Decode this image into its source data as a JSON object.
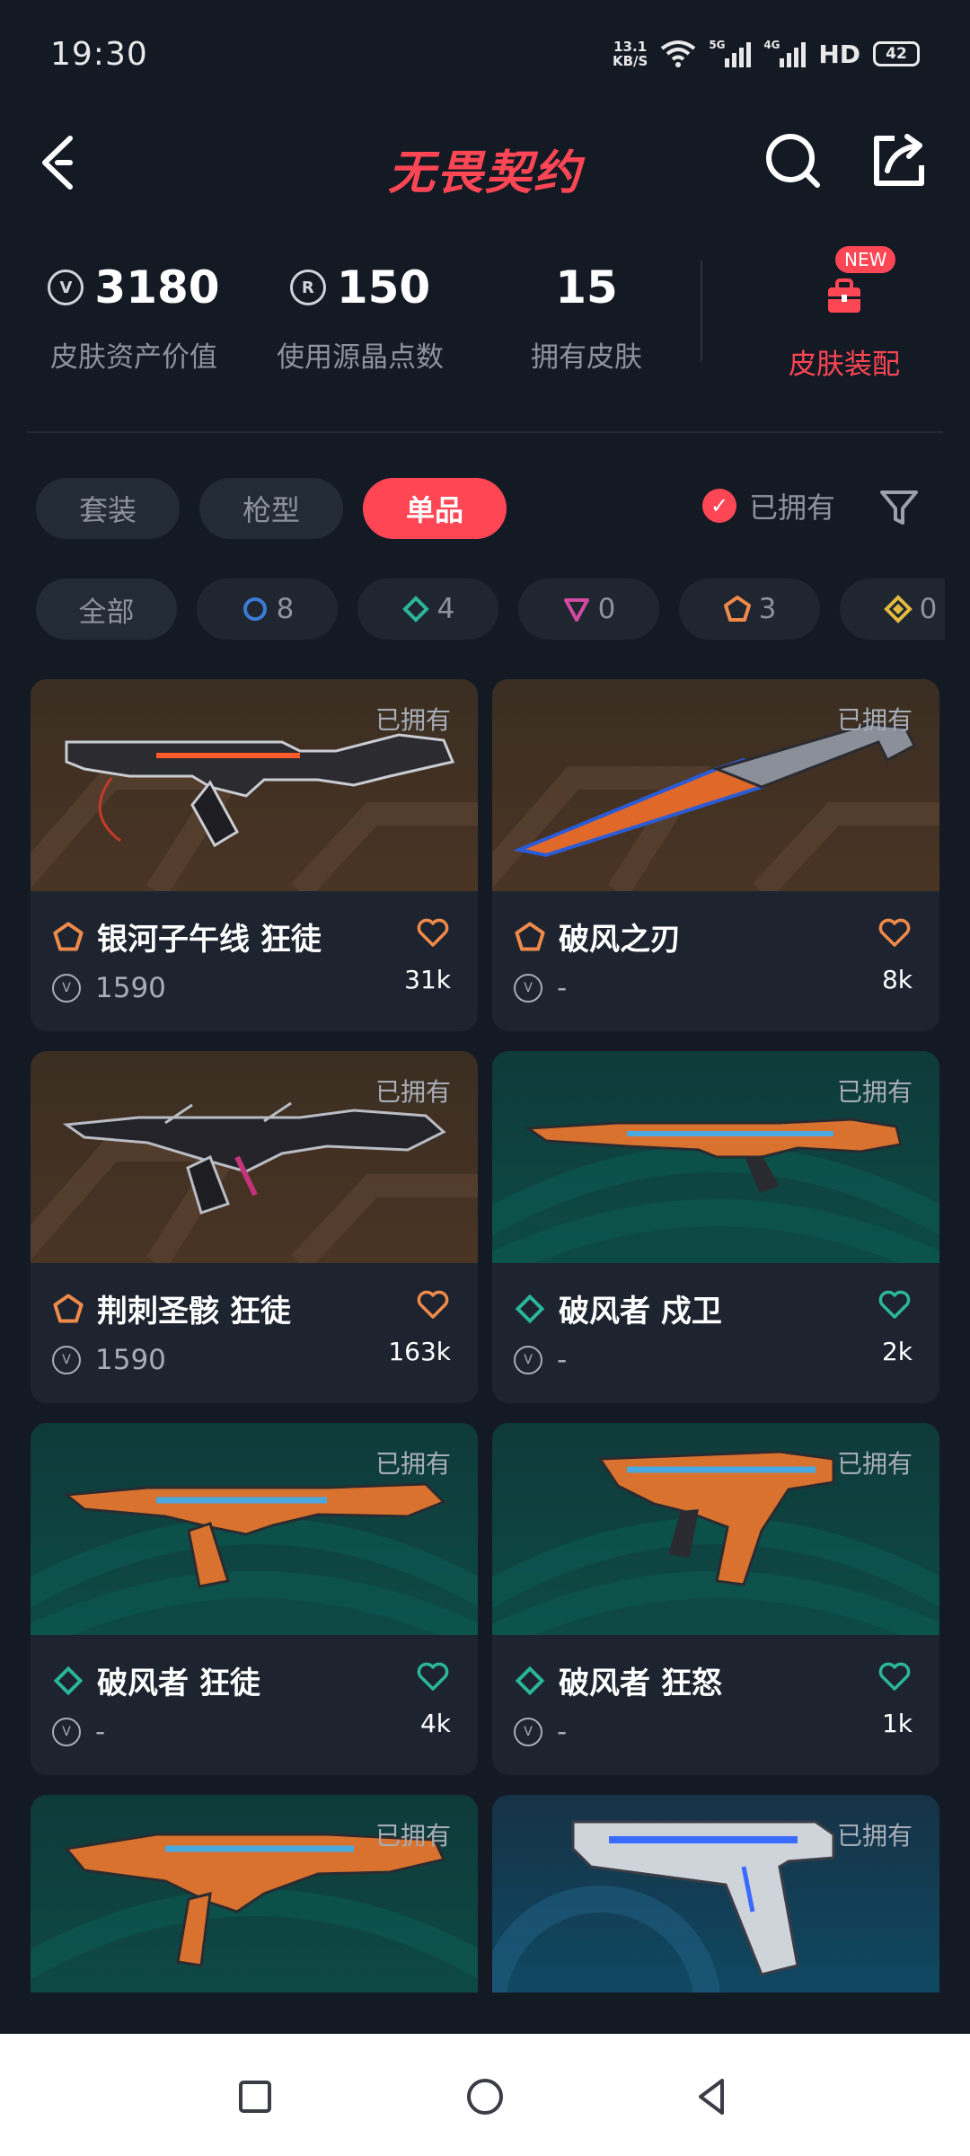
{
  "status_bar": {
    "time": "19:30",
    "net_speed_value": "13.1",
    "net_speed_unit": "KB/S",
    "signal1": "5G",
    "signal2": "4G",
    "hd": "HD",
    "battery": "42"
  },
  "app_bar": {
    "title": "无畏契约"
  },
  "stats": {
    "asset_value": "3180",
    "asset_label": "皮肤资产价值",
    "radianite": "150",
    "radianite_label": "使用源晶点数",
    "owned": "15",
    "owned_label": "拥有皮肤",
    "equip_label": "皮肤装配",
    "new_badge": "NEW"
  },
  "tabs": [
    {
      "label": "套装",
      "active": false
    },
    {
      "label": "枪型",
      "active": false
    },
    {
      "label": "单品",
      "active": true
    }
  ],
  "owned_filter": {
    "label": "已拥有"
  },
  "rarity_chips": [
    {
      "label": "全部"
    },
    {
      "count": "8",
      "color": "#3b7bd6",
      "shape": "circle"
    },
    {
      "count": "4",
      "color": "#2bb59b",
      "shape": "diamond"
    },
    {
      "count": "0",
      "color": "#d04aa0",
      "shape": "triangle"
    },
    {
      "count": "3",
      "color": "#f08a4b",
      "shape": "pentagon"
    },
    {
      "count": "0",
      "color": "#e3b93e",
      "shape": "gem"
    }
  ],
  "cards": [
    {
      "name": "银河子午线 狂徒",
      "price": "1590",
      "likes": "31k",
      "owned": "已拥有",
      "tier": "orange",
      "tier_color": "#f08a4b",
      "icon": "pentagon-icon"
    },
    {
      "name": "破风之刃",
      "price": "-",
      "likes": "8k",
      "owned": "已拥有",
      "tier": "orange",
      "tier_color": "#f08a4b",
      "icon": "pentagon-icon"
    },
    {
      "name": "荆刺圣骸 狂徒",
      "price": "1590",
      "likes": "163k",
      "owned": "已拥有",
      "tier": "orange",
      "tier_color": "#f08a4b",
      "icon": "pentagon-icon"
    },
    {
      "name": "破风者 戍卫",
      "price": "-",
      "likes": "2k",
      "owned": "已拥有",
      "tier": "teal",
      "tier_color": "#2bb59b",
      "icon": "diamond-icon"
    },
    {
      "name": "破风者 狂徒",
      "price": "-",
      "likes": "4k",
      "owned": "已拥有",
      "tier": "teal",
      "tier_color": "#2bb59b",
      "icon": "diamond-icon"
    },
    {
      "name": "破风者 狂怒",
      "price": "-",
      "likes": "1k",
      "owned": "已拥有",
      "tier": "teal",
      "tier_color": "#2bb59b",
      "icon": "diamond-icon"
    },
    {
      "owned": "已拥有",
      "tier": "teal"
    },
    {
      "owned": "已拥有",
      "tier": "blue"
    }
  ],
  "colors": {
    "accent": "#ff4655",
    "background": "#141a24",
    "card": "#1d242f",
    "chip": "#232b36"
  }
}
